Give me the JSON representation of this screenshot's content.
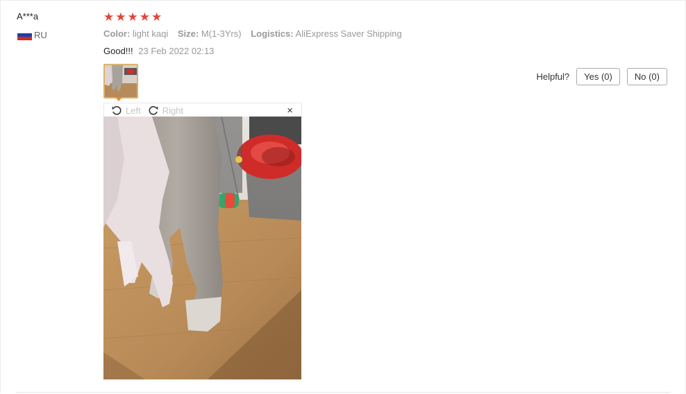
{
  "review": {
    "user_name": "A***a",
    "country_code": "RU",
    "rating": 5,
    "attributes": [
      {
        "key": "Color:",
        "value": "light kaqi"
      },
      {
        "key": "Size:",
        "value": "M(1-3Yrs)"
      },
      {
        "key": "Logistics:",
        "value": "AliExpress Saver Shipping"
      }
    ],
    "text": "Good!!!",
    "date": "23 Feb 2022 02:13"
  },
  "helpful": {
    "label": "Helpful?",
    "yes_label": "Yes (0)",
    "no_label": "No (0)"
  },
  "viewer": {
    "rotate_left_label": "Left",
    "rotate_right_label": "Right",
    "close_glyph": "×"
  },
  "icons": {
    "star": "star-icon",
    "rotate_left": "rotate-left-icon",
    "rotate_right": "rotate-right-icon",
    "close": "close-icon",
    "flag": "russia-flag-icon"
  },
  "colors": {
    "star": "#e34538",
    "thumb_border": "#d9b46b",
    "thumb_arrow": "#f08a24",
    "flag_white": "#ffffff",
    "flag_blue": "#1c3fa8",
    "flag_red": "#d52b1e"
  }
}
